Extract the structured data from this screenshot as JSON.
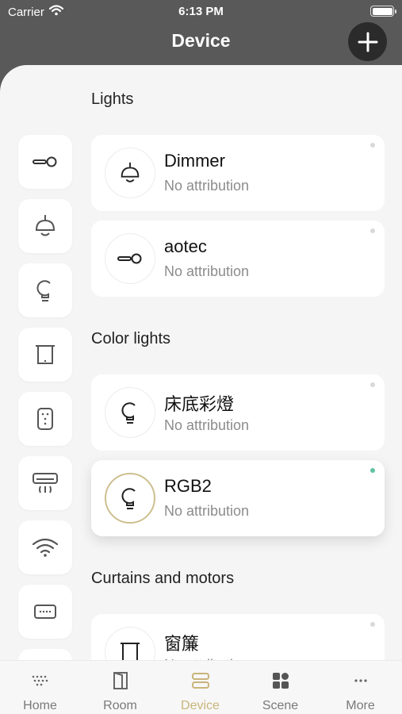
{
  "status": {
    "carrier": "Carrier",
    "time": "6:13 PM"
  },
  "header": {
    "title": "Device"
  },
  "sidebar": {
    "items": [
      {
        "icon": "switch-icon"
      },
      {
        "icon": "pendant-lamp-icon"
      },
      {
        "icon": "bulb-icon"
      },
      {
        "icon": "curtain-icon"
      },
      {
        "icon": "remote-icon"
      },
      {
        "icon": "air-conditioner-icon"
      },
      {
        "icon": "wifi-icon"
      },
      {
        "icon": "keyboard-icon"
      },
      {
        "icon": "more-device-icon"
      }
    ]
  },
  "sections": [
    {
      "title": "Lights",
      "devices": [
        {
          "name": "Dimmer",
          "subtitle": "No attribution",
          "icon": "pendant-lamp-icon",
          "online": false
        },
        {
          "name": "aotec",
          "subtitle": "No attribution",
          "icon": "switch-icon",
          "online": false
        }
      ]
    },
    {
      "title": "Color lights",
      "devices": [
        {
          "name": "床底彩燈",
          "subtitle": "No attribution",
          "icon": "bulb-icon",
          "online": false
        },
        {
          "name": "RGB2",
          "subtitle": "No attribution",
          "icon": "bulb-icon",
          "online": true
        }
      ]
    },
    {
      "title": "Curtains and motors",
      "devices": [
        {
          "name": "窗簾",
          "subtitle": "No attribution",
          "icon": "curtain-icon",
          "online": false
        }
      ]
    }
  ],
  "tabs": [
    {
      "label": "Home",
      "icon": "home-grid-icon",
      "active": false
    },
    {
      "label": "Room",
      "icon": "door-icon",
      "active": false
    },
    {
      "label": "Device",
      "icon": "device-icon",
      "active": true
    },
    {
      "label": "Scene",
      "icon": "scene-icon",
      "active": false
    },
    {
      "label": "More",
      "icon": "more-icon",
      "active": false
    }
  ],
  "colors": {
    "accent": "#c9b47a",
    "online": "#5fc3a0",
    "offline": "#d9d9d9",
    "header_bg": "#595959"
  }
}
